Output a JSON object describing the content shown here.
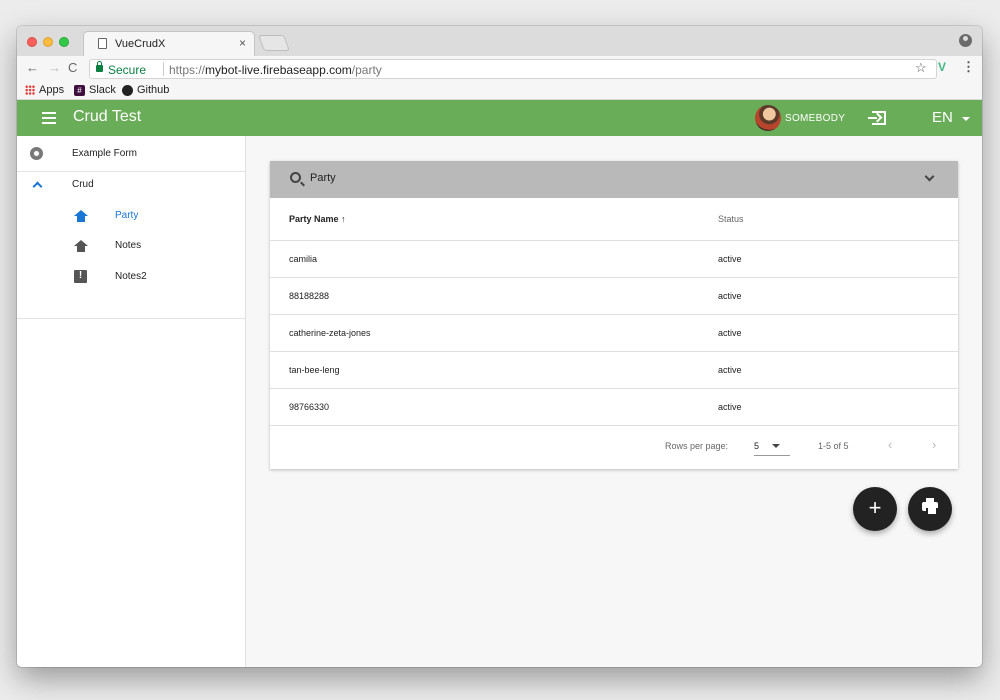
{
  "browser": {
    "tab_title": "VueCrudX",
    "tab_close": "×",
    "secure_label": "Secure",
    "url_scheme": "https://",
    "url_host": "mybot-live.firebaseapp.com",
    "url_path": "/party",
    "bookmarks": [
      {
        "label": "Apps",
        "icon": "apps-icon"
      },
      {
        "label": "Slack",
        "icon": "slack-icon"
      },
      {
        "label": "Github",
        "icon": "github-icon"
      }
    ]
  },
  "appbar": {
    "title": "Crud Test",
    "user": "SOMEBODY",
    "language": "EN",
    "color": "#6aad58"
  },
  "sidebar": {
    "items": [
      {
        "label": "Example Form",
        "icon": "gear-icon"
      },
      {
        "label": "Crud",
        "icon": "chevron-up-icon"
      },
      {
        "label": "Party",
        "icon": "home-icon",
        "active": true
      },
      {
        "label": "Notes",
        "icon": "home-icon"
      },
      {
        "label": "Notes2",
        "icon": "feedback-icon"
      }
    ],
    "active_color": "#1976d2"
  },
  "table": {
    "filter_text": "Party",
    "headers": {
      "name": "Party Name",
      "sort_indicator": "↑",
      "status": "Status"
    },
    "rows": [
      {
        "name": "camilia",
        "status": "active"
      },
      {
        "name": "88188288",
        "status": "active"
      },
      {
        "name": "catherine-zeta-jones",
        "status": "active"
      },
      {
        "name": "tan-bee-leng",
        "status": "active"
      },
      {
        "name": "98766330",
        "status": "active"
      }
    ],
    "footer": {
      "rows_per_page_label": "Rows per page:",
      "rows_per_page_value": "5",
      "range": "1-5 of 5",
      "prev": "‹",
      "next": "›"
    }
  },
  "fabs": {
    "add_label": "+",
    "print_icon": "printer-icon"
  }
}
